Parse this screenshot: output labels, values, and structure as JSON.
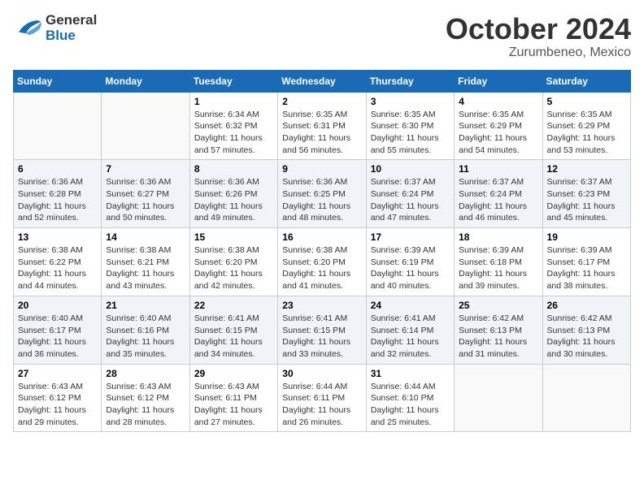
{
  "header": {
    "logo_line1": "General",
    "logo_line2": "Blue",
    "month": "October 2024",
    "location": "Zurumbeneo, Mexico"
  },
  "days_of_week": [
    "Sunday",
    "Monday",
    "Tuesday",
    "Wednesday",
    "Thursday",
    "Friday",
    "Saturday"
  ],
  "weeks": [
    [
      {
        "day": "",
        "detail": ""
      },
      {
        "day": "",
        "detail": ""
      },
      {
        "day": "1",
        "detail": "Sunrise: 6:34 AM\nSunset: 6:32 PM\nDaylight: 11 hours and 57 minutes."
      },
      {
        "day": "2",
        "detail": "Sunrise: 6:35 AM\nSunset: 6:31 PM\nDaylight: 11 hours and 56 minutes."
      },
      {
        "day": "3",
        "detail": "Sunrise: 6:35 AM\nSunset: 6:30 PM\nDaylight: 11 hours and 55 minutes."
      },
      {
        "day": "4",
        "detail": "Sunrise: 6:35 AM\nSunset: 6:29 PM\nDaylight: 11 hours and 54 minutes."
      },
      {
        "day": "5",
        "detail": "Sunrise: 6:35 AM\nSunset: 6:29 PM\nDaylight: 11 hours and 53 minutes."
      }
    ],
    [
      {
        "day": "6",
        "detail": "Sunrise: 6:36 AM\nSunset: 6:28 PM\nDaylight: 11 hours and 52 minutes."
      },
      {
        "day": "7",
        "detail": "Sunrise: 6:36 AM\nSunset: 6:27 PM\nDaylight: 11 hours and 50 minutes."
      },
      {
        "day": "8",
        "detail": "Sunrise: 6:36 AM\nSunset: 6:26 PM\nDaylight: 11 hours and 49 minutes."
      },
      {
        "day": "9",
        "detail": "Sunrise: 6:36 AM\nSunset: 6:25 PM\nDaylight: 11 hours and 48 minutes."
      },
      {
        "day": "10",
        "detail": "Sunrise: 6:37 AM\nSunset: 6:24 PM\nDaylight: 11 hours and 47 minutes."
      },
      {
        "day": "11",
        "detail": "Sunrise: 6:37 AM\nSunset: 6:24 PM\nDaylight: 11 hours and 46 minutes."
      },
      {
        "day": "12",
        "detail": "Sunrise: 6:37 AM\nSunset: 6:23 PM\nDaylight: 11 hours and 45 minutes."
      }
    ],
    [
      {
        "day": "13",
        "detail": "Sunrise: 6:38 AM\nSunset: 6:22 PM\nDaylight: 11 hours and 44 minutes."
      },
      {
        "day": "14",
        "detail": "Sunrise: 6:38 AM\nSunset: 6:21 PM\nDaylight: 11 hours and 43 minutes."
      },
      {
        "day": "15",
        "detail": "Sunrise: 6:38 AM\nSunset: 6:20 PM\nDaylight: 11 hours and 42 minutes."
      },
      {
        "day": "16",
        "detail": "Sunrise: 6:38 AM\nSunset: 6:20 PM\nDaylight: 11 hours and 41 minutes."
      },
      {
        "day": "17",
        "detail": "Sunrise: 6:39 AM\nSunset: 6:19 PM\nDaylight: 11 hours and 40 minutes."
      },
      {
        "day": "18",
        "detail": "Sunrise: 6:39 AM\nSunset: 6:18 PM\nDaylight: 11 hours and 39 minutes."
      },
      {
        "day": "19",
        "detail": "Sunrise: 6:39 AM\nSunset: 6:17 PM\nDaylight: 11 hours and 38 minutes."
      }
    ],
    [
      {
        "day": "20",
        "detail": "Sunrise: 6:40 AM\nSunset: 6:17 PM\nDaylight: 11 hours and 36 minutes."
      },
      {
        "day": "21",
        "detail": "Sunrise: 6:40 AM\nSunset: 6:16 PM\nDaylight: 11 hours and 35 minutes."
      },
      {
        "day": "22",
        "detail": "Sunrise: 6:41 AM\nSunset: 6:15 PM\nDaylight: 11 hours and 34 minutes."
      },
      {
        "day": "23",
        "detail": "Sunrise: 6:41 AM\nSunset: 6:15 PM\nDaylight: 11 hours and 33 minutes."
      },
      {
        "day": "24",
        "detail": "Sunrise: 6:41 AM\nSunset: 6:14 PM\nDaylight: 11 hours and 32 minutes."
      },
      {
        "day": "25",
        "detail": "Sunrise: 6:42 AM\nSunset: 6:13 PM\nDaylight: 11 hours and 31 minutes."
      },
      {
        "day": "26",
        "detail": "Sunrise: 6:42 AM\nSunset: 6:13 PM\nDaylight: 11 hours and 30 minutes."
      }
    ],
    [
      {
        "day": "27",
        "detail": "Sunrise: 6:43 AM\nSunset: 6:12 PM\nDaylight: 11 hours and 29 minutes."
      },
      {
        "day": "28",
        "detail": "Sunrise: 6:43 AM\nSunset: 6:12 PM\nDaylight: 11 hours and 28 minutes."
      },
      {
        "day": "29",
        "detail": "Sunrise: 6:43 AM\nSunset: 6:11 PM\nDaylight: 11 hours and 27 minutes."
      },
      {
        "day": "30",
        "detail": "Sunrise: 6:44 AM\nSunset: 6:11 PM\nDaylight: 11 hours and 26 minutes."
      },
      {
        "day": "31",
        "detail": "Sunrise: 6:44 AM\nSunset: 6:10 PM\nDaylight: 11 hours and 25 minutes."
      },
      {
        "day": "",
        "detail": ""
      },
      {
        "day": "",
        "detail": ""
      }
    ]
  ]
}
